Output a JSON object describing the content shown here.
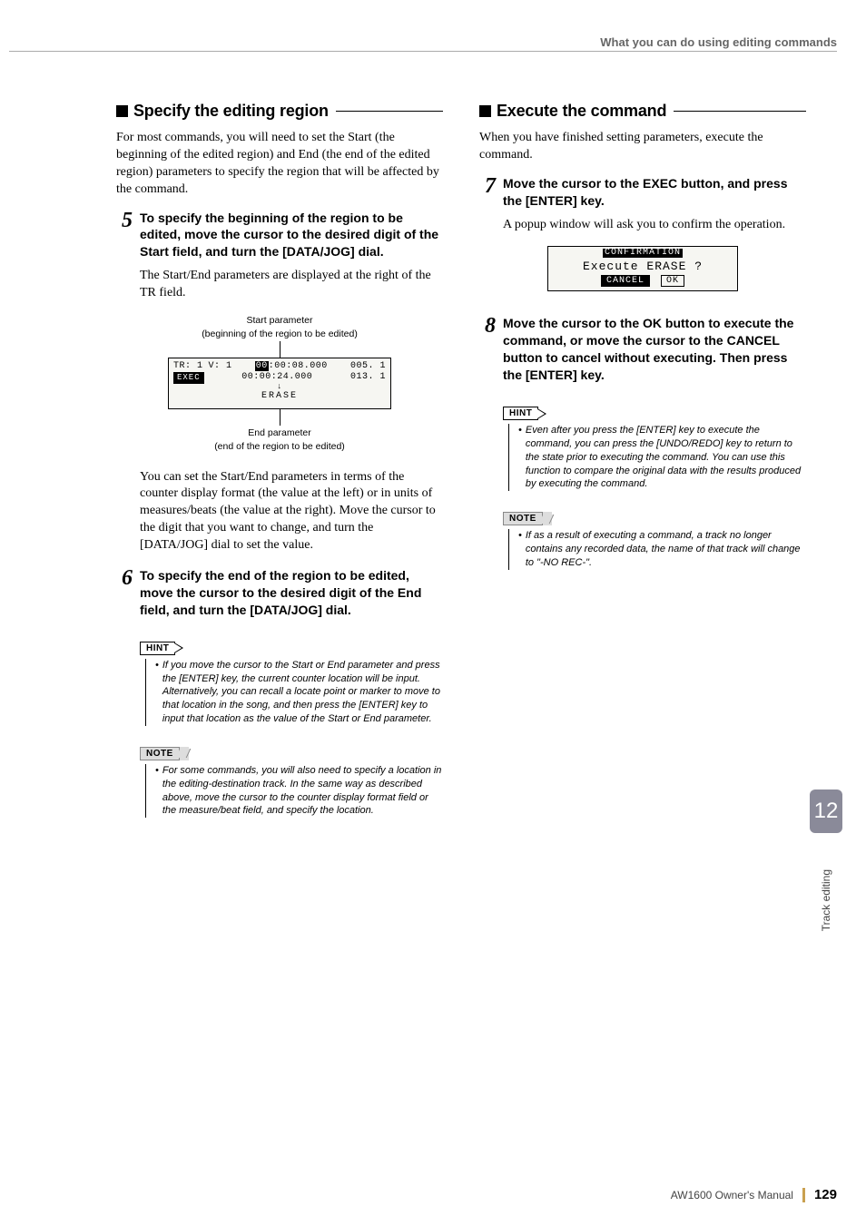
{
  "header": {
    "running_head": "What you can do using editing commands"
  },
  "left": {
    "section_title": "Specify the editing region",
    "intro": "For most commands, you will need to set the Start (the beginning of the edited region) and End (the end of the edited region) parameters to specify the region that will be affected by the command.",
    "step5": {
      "num": "5",
      "title": "To specify the beginning of the region to be edited, move the cursor to the desired digit of the Start field, and turn the [DATA/JOG] dial.",
      "body": "The Start/End parameters are displayed at the right of the TR field."
    },
    "diagram": {
      "top_label1": "Start parameter",
      "top_label2": "(beginning of the region to be edited)",
      "lcd": {
        "tr": "TR: 1",
        "v": "V: 1",
        "start_tc": "00:00:08.000",
        "start_mb": "005. 1",
        "end_tc": "00:00:24.000",
        "end_mb": "013. 1",
        "exec": "EXEC",
        "arrowdown": "↓",
        "erase": "ERASE"
      },
      "bottom_label1": "End parameter",
      "bottom_label2": "(end of the region to be edited)"
    },
    "after_diagram": "You can set the Start/End parameters in terms of the counter display format (the value at the left) or in units of measures/beats (the value at the right). Move the cursor to the digit that you want to change, and turn the [DATA/JOG] dial to set the value.",
    "step6": {
      "num": "6",
      "title": "To specify the end of the region to be edited, move the cursor to the desired digit of the End field, and turn the [DATA/JOG] dial."
    },
    "hint_label": "HINT",
    "hint_text": "If you move the cursor to the Start or End parameter and press the [ENTER] key, the current counter location will be input. Alternatively, you can recall a locate point or marker to move to that location in the song, and then press the [ENTER] key to input that location as the value of the Start or End parameter.",
    "note_label": "NOTE",
    "note_text": "For some commands, you will also need to specify a location in the editing-destination track. In the same way as described above, move the cursor to the counter display format field or the measure/beat field, and specify the location."
  },
  "right": {
    "section_title": "Execute the command",
    "intro": "When you have finished setting parameters, execute the command.",
    "step7": {
      "num": "7",
      "title": "Move the cursor to the EXEC button, and press the [ENTER] key.",
      "body": "A popup window will ask you to confirm the operation."
    },
    "popup": {
      "title": "CONFIRMATION",
      "line": "Execute ERASE ?",
      "cancel": "CANCEL",
      "ok": "OK"
    },
    "step8": {
      "num": "8",
      "title": "Move the cursor to the OK button to execute the command, or move the cursor to the CANCEL button to cancel without executing. Then press the [ENTER] key."
    },
    "hint_label": "HINT",
    "hint_text": "Even after you press the [ENTER] key to execute the command, you can press the [UNDO/REDO] key to return to the state prior to executing the command. You can use this function to compare the original data with the results produced by executing the command.",
    "note_label": "NOTE",
    "note_text": "If as a result of executing a command, a track no longer contains any recorded data, the name of that track will change to \"-NO REC-\"."
  },
  "side": {
    "chapter": "12",
    "label": "Track editing"
  },
  "footer": {
    "manual": "AW1600  Owner's Manual",
    "page": "129"
  }
}
